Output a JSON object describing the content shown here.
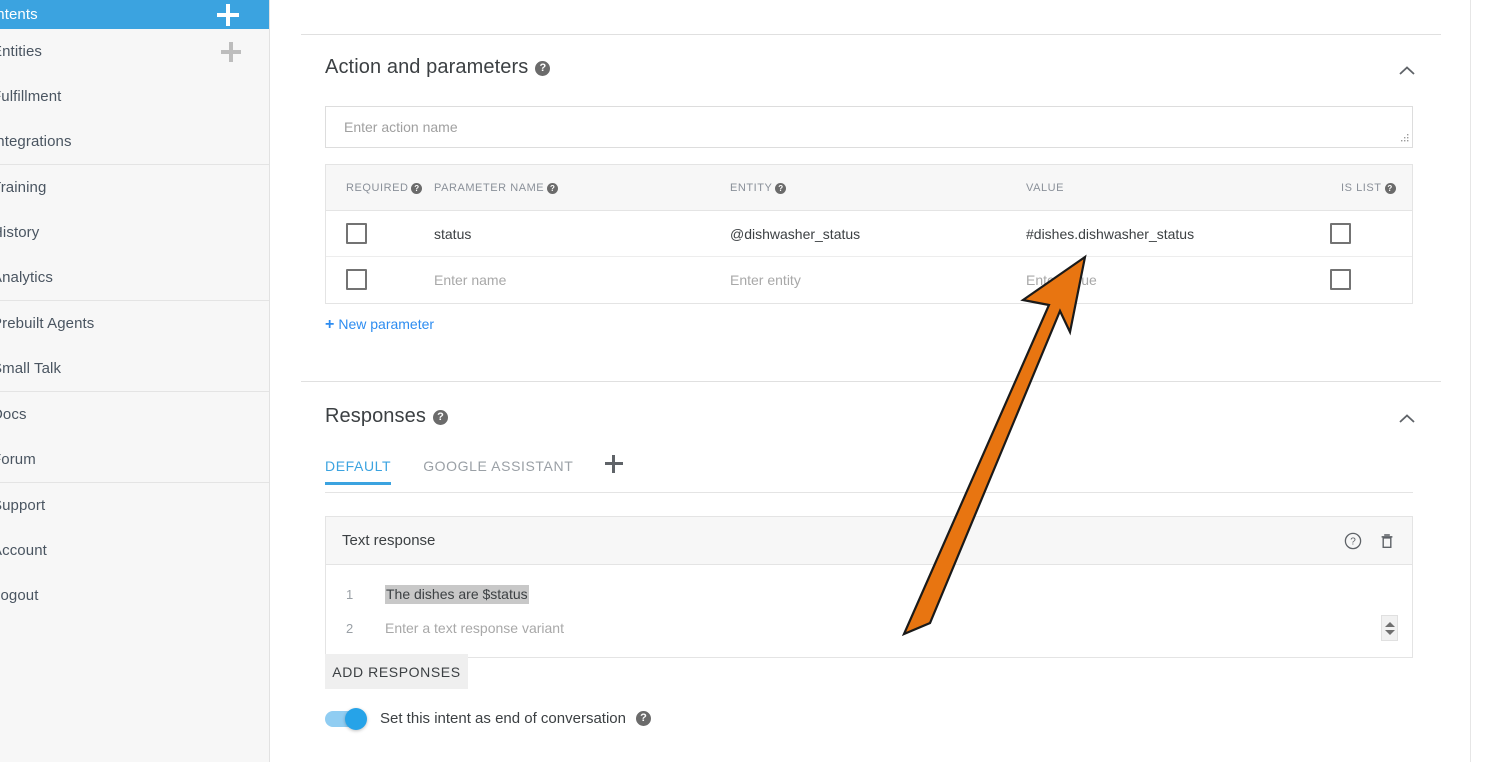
{
  "sidebar": {
    "groups": [
      {
        "items": [
          {
            "label": "Intents",
            "active": true,
            "plus": true,
            "icon": "plus-icon"
          },
          {
            "label": "Entities",
            "active": false,
            "plus": true,
            "icon": "plus-icon"
          },
          {
            "label": "Fulfillment",
            "active": false,
            "plus": false
          },
          {
            "label": "Integrations",
            "active": false,
            "plus": false
          }
        ]
      },
      {
        "items": [
          {
            "label": "Training",
            "active": false,
            "plus": false
          },
          {
            "label": "History",
            "active": false,
            "plus": false
          },
          {
            "label": "Analytics",
            "active": false,
            "plus": false
          }
        ]
      },
      {
        "items": [
          {
            "label": "Prebuilt Agents",
            "active": false,
            "plus": false
          },
          {
            "label": "Small Talk",
            "active": false,
            "plus": false
          }
        ]
      },
      {
        "items": [
          {
            "label": "Docs",
            "active": false,
            "plus": false
          },
          {
            "label": "Forum",
            "active": false,
            "plus": false
          }
        ]
      },
      {
        "items": [
          {
            "label": "Support",
            "active": false,
            "plus": false
          },
          {
            "label": "Account",
            "active": false,
            "plus": false
          },
          {
            "label": "Logout",
            "active": false,
            "plus": false
          }
        ]
      }
    ]
  },
  "action_section": {
    "title": "Action and parameters",
    "help": "?",
    "collapse_icon": "chevron-up-icon",
    "action_input": {
      "value": "",
      "placeholder": "Enter action name"
    },
    "table": {
      "headers": [
        {
          "label": "REQUIRED",
          "help": "?"
        },
        {
          "label": "PARAMETER NAME",
          "help": "?"
        },
        {
          "label": "ENTITY",
          "help": "?"
        },
        {
          "label": "VALUE",
          "help": ""
        },
        {
          "label": "IS LIST",
          "help": "?"
        }
      ],
      "rows": [
        {
          "required_checked": false,
          "name": "status",
          "entity": "@dishwasher_status",
          "value": "#dishes.dishwasher_status",
          "is_list_checked": false,
          "is_placeholder": false
        },
        {
          "required_checked": false,
          "name": "Enter name",
          "entity": "Enter entity",
          "value": "Enter value",
          "is_list_checked": false,
          "is_placeholder": true
        }
      ]
    },
    "new_parameter": {
      "plus": "+",
      "label": "New parameter"
    }
  },
  "responses_section": {
    "title": "Responses",
    "help": "?",
    "collapse_icon": "chevron-up-icon",
    "tabs": [
      {
        "label": "DEFAULT",
        "active": true
      },
      {
        "label": "GOOGLE ASSISTANT",
        "active": false
      }
    ],
    "add_tab_icon": "plus-icon",
    "card": {
      "title": "Text response",
      "help_icon": "help-circle-icon",
      "delete_icon": "trash-icon",
      "lines": [
        {
          "num": "1",
          "text": "The dishes are $status",
          "selected": true,
          "placeholder": false
        },
        {
          "num": "2",
          "text": "Enter a text response variant",
          "selected": false,
          "placeholder": true
        }
      ],
      "spinner_icon": "up-down-spinner-icon"
    },
    "add_responses_button": "ADD RESPONSES",
    "end_of_conversation": {
      "label": "Set this intent as end of conversation",
      "help": "?",
      "enabled": true
    }
  },
  "annotation": {
    "type": "arrow",
    "color": "#E87511",
    "outline": "#1a1a1a",
    "points_to": "#dishes.dishwasher_status"
  },
  "colors": {
    "accent_blue": "#3ba3e0",
    "link_blue": "#2d8cf0",
    "sidebar_bg": "#f7f7f7",
    "arrow_orange": "#E87511"
  }
}
